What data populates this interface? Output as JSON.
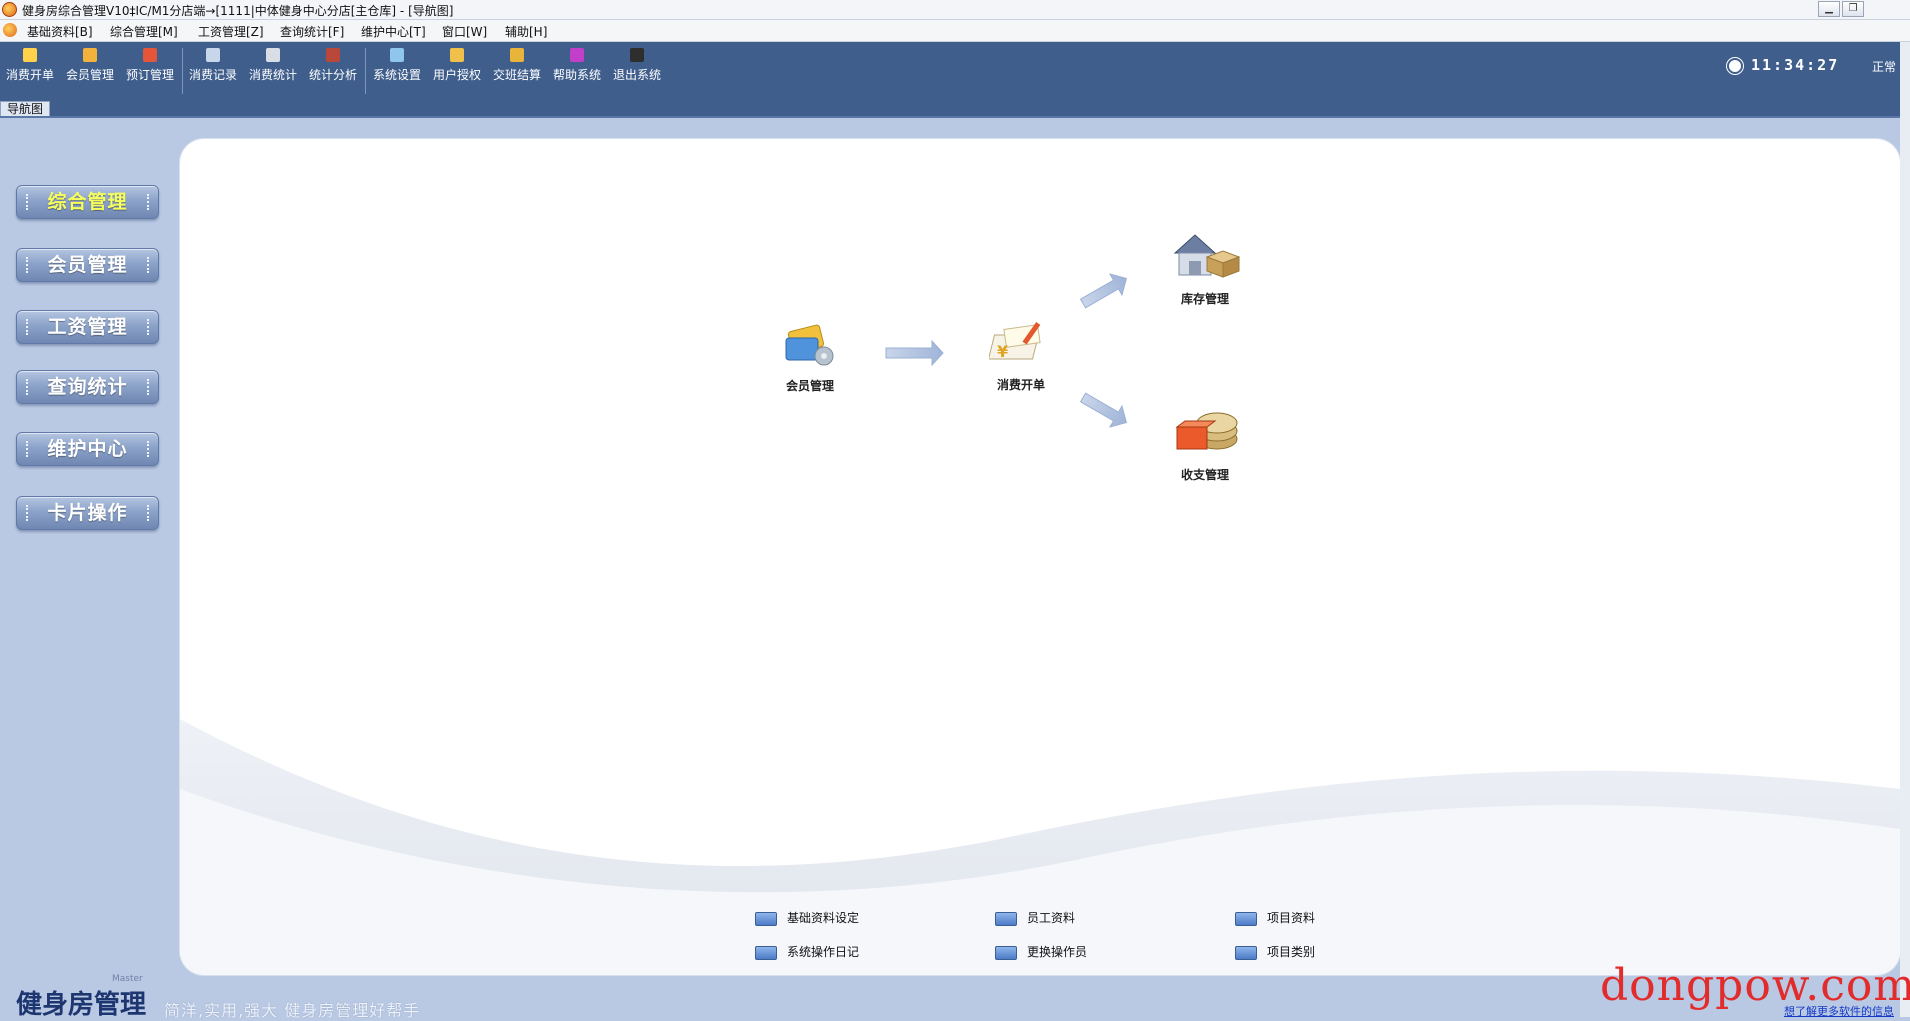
{
  "window": {
    "title": "健身房综合管理V10‡IC/M1分店端→[1111|中体健身中心分店[主仓库] - [导航图]",
    "controls": [
      "minimize-icon",
      "restore-icon"
    ]
  },
  "menubar": {
    "items": [
      "基础资料[B]",
      "综合管理[M]",
      "工资管理[Z]",
      "查询统计[F]",
      "维护中心[T]",
      "窗口[W]",
      "辅助[H]"
    ]
  },
  "toolbar": {
    "buttons": [
      {
        "label": "消费开单",
        "icon": "bill-icon"
      },
      {
        "label": "会员管理",
        "icon": "members-icon"
      },
      {
        "label": "预订管理",
        "icon": "booking-icon"
      },
      {
        "label": "消费记录",
        "icon": "records-icon"
      },
      {
        "label": "消费统计",
        "icon": "stats-icon"
      },
      {
        "label": "统计分析",
        "icon": "analysis-icon"
      },
      {
        "label": "系统设置",
        "icon": "settings-icon"
      },
      {
        "label": "用户授权",
        "icon": "user-auth-icon"
      },
      {
        "label": "交班结算",
        "icon": "shift-settle-icon"
      },
      {
        "label": "帮助系统",
        "icon": "help-icon"
      },
      {
        "label": "退出系统",
        "icon": "exit-icon"
      }
    ],
    "time": "11:34:27",
    "status": "正常"
  },
  "tab": {
    "label": "导航图"
  },
  "sidebar": {
    "items": [
      {
        "label": "综合管理",
        "active": true
      },
      {
        "label": "会员管理"
      },
      {
        "label": "工资管理"
      },
      {
        "label": "查询统计"
      },
      {
        "label": "维护中心"
      },
      {
        "label": "卡片操作"
      }
    ]
  },
  "flow": {
    "members": "会员管理",
    "billing": "消费开单",
    "inventory": "库存管理",
    "finance": "收支管理"
  },
  "links": [
    {
      "label": "基础资料设定"
    },
    {
      "label": "员工资料"
    },
    {
      "label": "项目资料"
    },
    {
      "label": "系统操作日记"
    },
    {
      "label": "更换操作员"
    },
    {
      "label": "项目类别"
    }
  ],
  "footer": {
    "brand": "健身房管理",
    "brand_small": "Master",
    "slogan": "简洋,实用,强大  健身房管理好帮手",
    "watermark": "dongpow.com",
    "more_link": "想了解更多软件的信息"
  },
  "colors": {
    "toolbar_bg": "#3f5e8c",
    "background": "#b9c8e3",
    "sidebar_active_text": "#f6ff5c",
    "watermark": "#e22c2c"
  }
}
